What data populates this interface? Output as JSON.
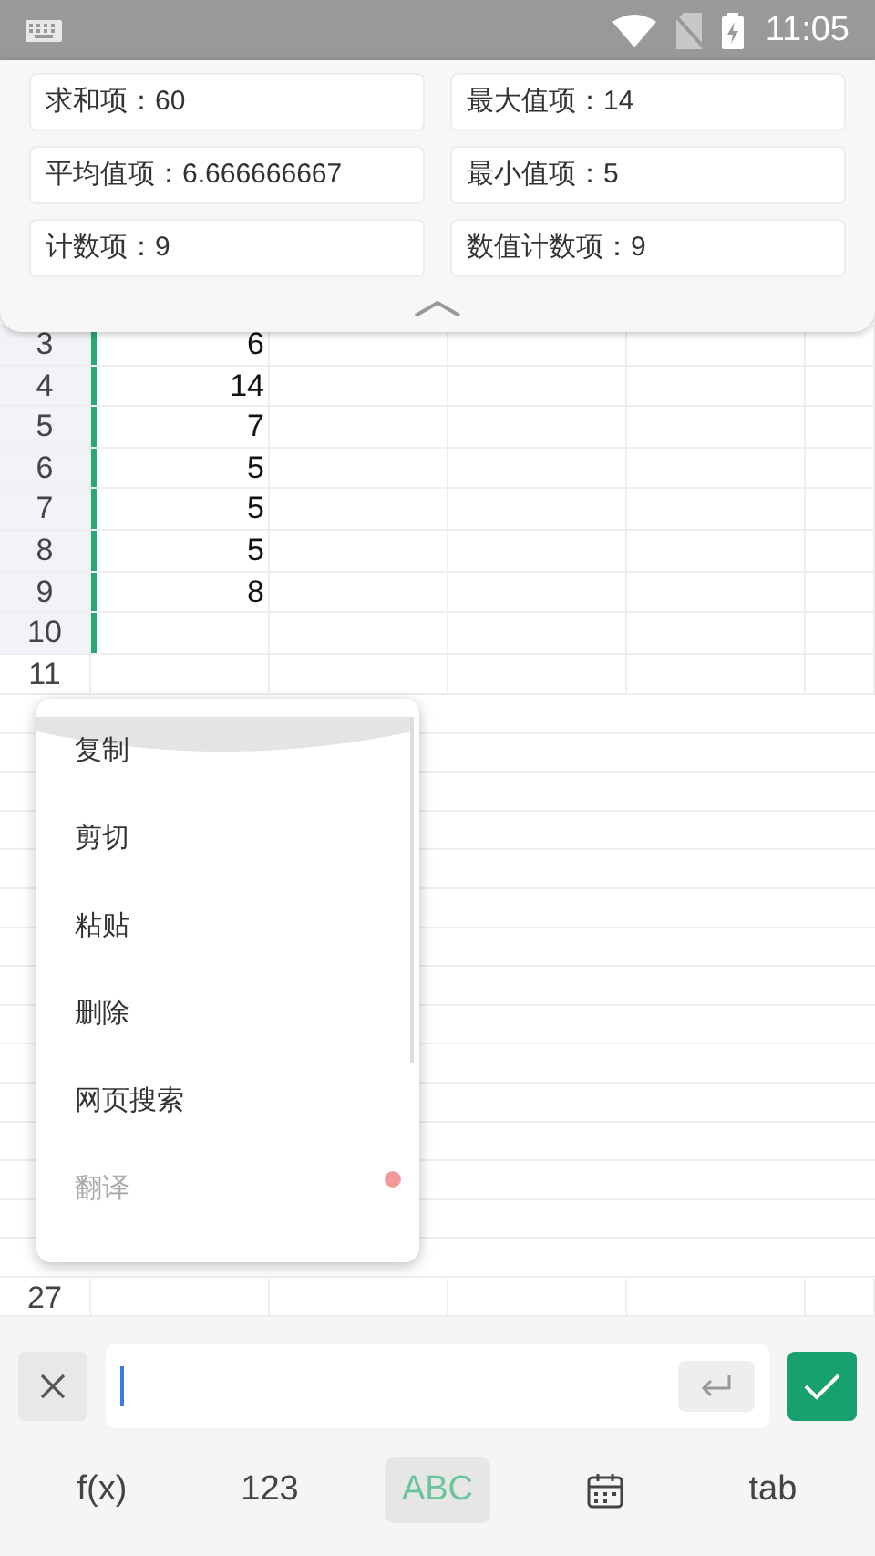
{
  "status_bar": {
    "time": "11:05"
  },
  "summary": [
    {
      "label": "求和项：60"
    },
    {
      "label": "最大值项：14"
    },
    {
      "label": "平均值项：6.666666667"
    },
    {
      "label": "最小值项：5"
    },
    {
      "label": "计数项：9"
    },
    {
      "label": "数值计数项：9"
    }
  ],
  "rows": [
    {
      "number": "3",
      "value": "6",
      "selected": true
    },
    {
      "number": "4",
      "value": "14",
      "selected": true
    },
    {
      "number": "5",
      "value": "7",
      "selected": true
    },
    {
      "number": "6",
      "value": "5",
      "selected": true
    },
    {
      "number": "7",
      "value": "5",
      "selected": true
    },
    {
      "number": "8",
      "value": "5",
      "selected": true
    },
    {
      "number": "9",
      "value": "8",
      "selected": true
    },
    {
      "number": "10",
      "value": "",
      "selected": true
    },
    {
      "number": "11",
      "value": "",
      "selected": false
    },
    {
      "number": "27",
      "value": "",
      "selected": false
    }
  ],
  "context_menu": [
    {
      "label": "复制",
      "disabled": false
    },
    {
      "label": "剪切",
      "disabled": false
    },
    {
      "label": "粘贴",
      "disabled": false
    },
    {
      "label": "删除",
      "disabled": false
    },
    {
      "label": "网页搜索",
      "disabled": false
    },
    {
      "label": "翻译",
      "disabled": true
    }
  ],
  "keyboard_tabs": [
    {
      "label": "f(x)",
      "kind": "text",
      "selected": false
    },
    {
      "label": "123",
      "kind": "text",
      "selected": false
    },
    {
      "label": "ABC",
      "kind": "text",
      "selected": true
    },
    {
      "kind": "calendar",
      "selected": false
    },
    {
      "label": "tab",
      "kind": "tab",
      "selected": false
    }
  ]
}
